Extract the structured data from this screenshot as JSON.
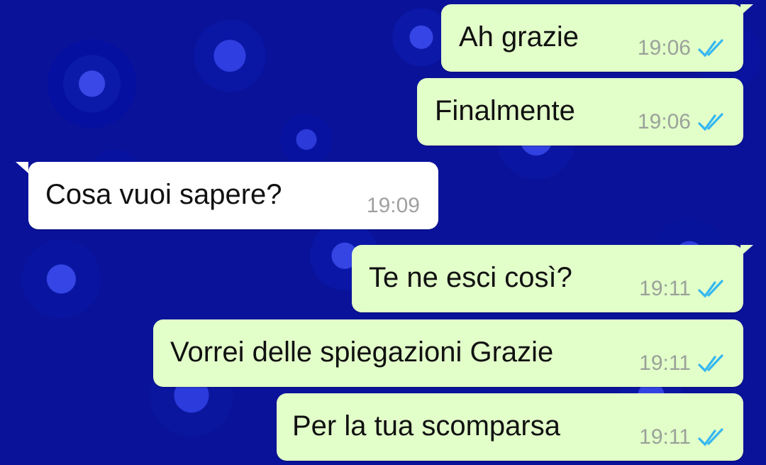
{
  "colors": {
    "outgoing_bubble": "#e2fec9",
    "incoming_bubble": "#ffffff",
    "read_ticks": "#34b7f1",
    "wallpaper": "#0a129a"
  },
  "messages": [
    {
      "direction": "outgoing",
      "text": "Ah grazie",
      "time": "19:06",
      "status_icon": "double-check-read-icon"
    },
    {
      "direction": "outgoing",
      "text": "Finalmente",
      "time": "19:06",
      "status_icon": "double-check-read-icon"
    },
    {
      "direction": "incoming",
      "text": "Cosa vuoi sapere?",
      "time": "19:09"
    },
    {
      "direction": "outgoing",
      "text": "Te ne esci così?",
      "time": "19:11",
      "status_icon": "double-check-read-icon"
    },
    {
      "direction": "outgoing",
      "text": "Vorrei delle spiegazioni Grazie",
      "time": "19:11",
      "status_icon": "double-check-read-icon"
    },
    {
      "direction": "outgoing",
      "text": "Per la tua scomparsa",
      "time": "19:11",
      "status_icon": "double-check-read-icon"
    }
  ]
}
